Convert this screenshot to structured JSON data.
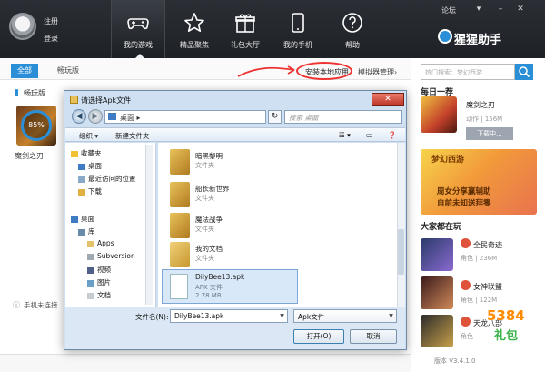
{
  "topbar": {
    "login": {
      "register": "注册",
      "login": "登录"
    },
    "tabs": [
      {
        "label": "我的游戏",
        "icon": "gamepad-icon",
        "active": true
      },
      {
        "label": "精品聚焦",
        "icon": "star-icon"
      },
      {
        "label": "礼包大厅",
        "icon": "gift-icon"
      },
      {
        "label": "我的手机",
        "icon": "phone-icon"
      },
      {
        "label": "帮助",
        "icon": "question-icon"
      }
    ],
    "forum": "论坛",
    "brand": "猩猩助手"
  },
  "main": {
    "subtabs": [
      {
        "label": "全部"
      },
      {
        "label": "畅玩版"
      }
    ],
    "install_local": "安装本地应用",
    "emulator_mgr": "模拟器管理",
    "section_title": "畅玩版",
    "game_card": {
      "name": "魔剑之刃",
      "progress": "85%"
    },
    "phone_status": "手机未连接"
  },
  "sidebar": {
    "search_placeholder": "热门搜索：梦幻西游",
    "daily_title": "每日一荐",
    "daily": {
      "name": "魔剑之刃",
      "meta_kind": "动作",
      "meta_size": "156M",
      "download": "下载中..."
    },
    "banner": {
      "title": "梦幻西游",
      "line1": "周女分享赢辅助",
      "line2": "自前未知送拜零"
    },
    "popular_title": "大家都在玩",
    "popular": [
      {
        "name": "全民奇迹",
        "meta_kind": "角色",
        "meta_size": "236M"
      },
      {
        "name": "女神联盟",
        "meta_kind": "角色",
        "meta_size": "122M"
      },
      {
        "name": "天龙八部",
        "meta_kind": "角色",
        "meta_size": ""
      }
    ],
    "watermark": "5384",
    "watermark2": "礼包",
    "version": "版本 V3.4.1.0"
  },
  "dialog": {
    "title": "请选择Apk文件",
    "address": "桌面",
    "search_placeholder": "搜索 桌面",
    "toolbar": {
      "organize": "组织",
      "new_folder": "新建文件夹"
    },
    "nav": {
      "favorites": "收藏夹",
      "desktop": "桌面",
      "recent": "最近访问的位置",
      "downloads": "下载",
      "desktop2": "桌面",
      "libraries": "库",
      "apps": "Apps",
      "subversion": "Subversion",
      "videos": "视频",
      "pictures": "图片",
      "documents": "文档"
    },
    "files": [
      {
        "name": "暗黑黎明",
        "type": "文件夹"
      },
      {
        "name": "船长新世界",
        "type": "文件夹"
      },
      {
        "name": "魔法战争",
        "type": "文件夹"
      },
      {
        "name": "我的文档",
        "type": "文件夹"
      }
    ],
    "selected_file": {
      "name": "DilyBee13.apk",
      "type": "APK 文件",
      "size": "2.78 MB"
    },
    "filename_label": "文件名(N):",
    "filename_value": "DilyBee13.apk",
    "filetype_value": "Apk文件",
    "open_label": "打开(O)",
    "cancel_label": "取消"
  }
}
